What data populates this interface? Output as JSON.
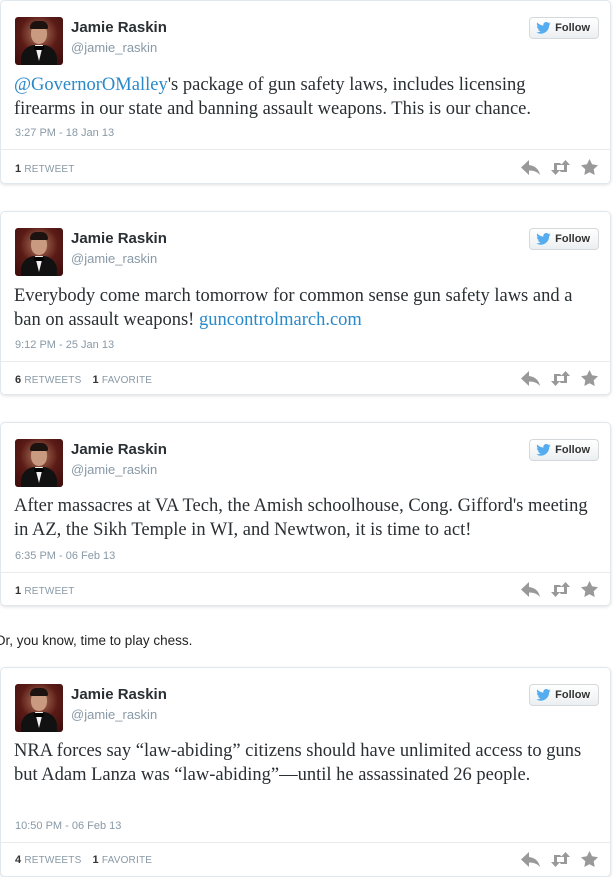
{
  "tweets": [
    {
      "name": "Jamie Raskin",
      "handle": "@jamie_raskin",
      "follow_label": "Follow",
      "mention": "@GovernorOMalley",
      "text_after_mention": "'s package of gun safety laws, includes licensing firearms in our state and banning assault weapons. This is our chance.",
      "timestamp": "3:27 PM - 18 Jan 13",
      "retweets": "1",
      "retweets_label": "RETWEET",
      "favorites": "",
      "favorites_label": ""
    },
    {
      "name": "Jamie Raskin",
      "handle": "@jamie_raskin",
      "follow_label": "Follow",
      "text_before_link": "Everybody come march tomorrow for common sense gun safety laws and a ban on assault weapons! ",
      "link": "guncontrolmarch.com",
      "timestamp": "9:12 PM - 25 Jan 13",
      "retweets": "6",
      "retweets_label": "RETWEETS",
      "favorites": "1",
      "favorites_label": "FAVORITE"
    },
    {
      "name": "Jamie Raskin",
      "handle": "@jamie_raskin",
      "follow_label": "Follow",
      "text": "After massacres at VA Tech, the Amish schoolhouse, Cong. Gifford's meeting in AZ, the Sikh Temple in WI, and Newtwon, it is time to act!",
      "timestamp": "6:35 PM - 06 Feb 13",
      "retweets": "1",
      "retweets_label": "RETWEET",
      "favorites": "",
      "favorites_label": ""
    },
    {
      "name": "Jamie Raskin",
      "handle": "@jamie_raskin",
      "follow_label": "Follow",
      "text": "NRA forces say “law-abiding” citizens should have unlimited access to guns but Adam Lanza was “law-abiding”—until he assassinated 26 people.",
      "timestamp": "10:50 PM - 06 Feb 13",
      "retweets": "4",
      "retweets_label": "RETWEETS",
      "favorites": "1",
      "favorites_label": "FAVORITE"
    }
  ],
  "interlude_text": "Or, you know, time to play chess.",
  "colors": {
    "link": "#2a89c8",
    "meta": "#8899a6",
    "twitter_blue": "#55acee",
    "action_gray": "#999999"
  },
  "icons": [
    "twitter-bird-icon",
    "reply-icon",
    "retweet-icon",
    "favorite-star-icon"
  ]
}
